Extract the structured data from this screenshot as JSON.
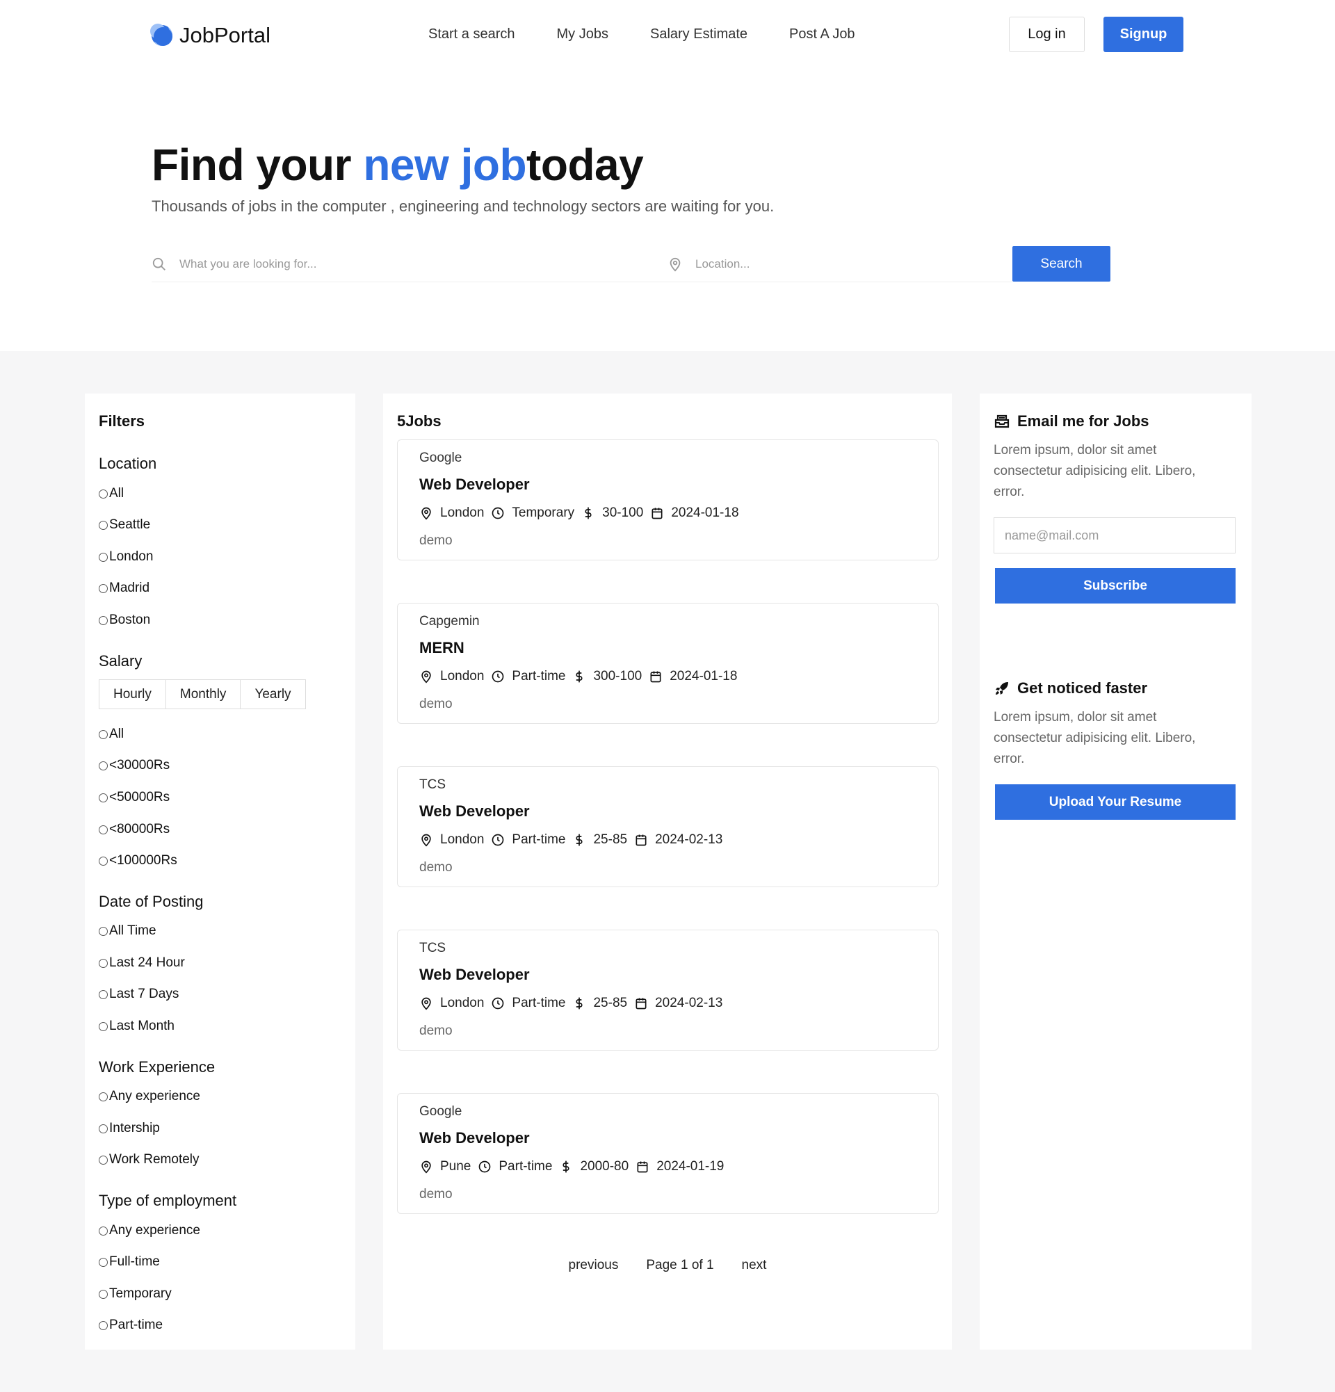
{
  "header": {
    "logo": "JobPortal",
    "menu": [
      "Start a search",
      "My Jobs",
      "Salary Estimate",
      "Post A Job"
    ],
    "login": "Log in",
    "signup": "Signup"
  },
  "hero": {
    "title_part1": "Find your ",
    "title_highlight": "new job",
    "title_part2": "today",
    "subtitle": "Thousands of jobs in the computer , engineering and technology sectors are waiting for you.",
    "search_placeholder": "What you are looking for...",
    "location_placeholder": "Location...",
    "search_button": "Search"
  },
  "filters": {
    "title": "Filters",
    "location": {
      "label": "Location",
      "options": [
        "All",
        "Seattle",
        "London",
        "Madrid",
        "Boston"
      ]
    },
    "salary": {
      "label": "Salary",
      "tabs": [
        "Hourly",
        "Monthly",
        "Yearly"
      ],
      "options": [
        "All",
        "<30000Rs",
        "<50000Rs",
        "<80000Rs",
        "<100000Rs"
      ]
    },
    "date": {
      "label": "Date of Posting",
      "options": [
        "All Time",
        "Last 24 Hour",
        "Last 7 Days",
        "Last Month"
      ]
    },
    "experience": {
      "label": "Work Experience",
      "options": [
        "Any experience",
        "Intership",
        "Work Remotely"
      ]
    },
    "employment": {
      "label": "Type of employment",
      "options": [
        "Any experience",
        "Full-time",
        "Temporary",
        "Part-time"
      ]
    }
  },
  "jobs": {
    "count": "5Jobs",
    "items": [
      {
        "company": "Google",
        "role": "Web Developer",
        "location": "London",
        "type": "Temporary",
        "salary": "30-100",
        "date": "2024-01-18",
        "desc": "demo"
      },
      {
        "company": "Capgemin",
        "role": "MERN",
        "location": "London",
        "type": "Part-time",
        "salary": "300-100",
        "date": "2024-01-18",
        "desc": "demo"
      },
      {
        "company": "TCS",
        "role": "Web Developer",
        "location": "London",
        "type": "Part-time",
        "salary": "25-85",
        "date": "2024-02-13",
        "desc": "demo"
      },
      {
        "company": "TCS",
        "role": "Web Developer",
        "location": "London",
        "type": "Part-time",
        "salary": "25-85",
        "date": "2024-02-13",
        "desc": "demo"
      },
      {
        "company": "Google",
        "role": "Web Developer",
        "location": "Pune",
        "type": "Part-time",
        "salary": "2000-80",
        "date": "2024-01-19",
        "desc": "demo"
      }
    ],
    "pager": {
      "previous": "previous",
      "page": "Page 1 of 1",
      "next": "next"
    }
  },
  "side": {
    "email_title": "Email me for Jobs",
    "email_text": "Lorem ipsum, dolor sit amet consectetur adipisicing elit. Libero, error.",
    "email_placeholder": "name@mail.com",
    "subscribe": "Subscribe",
    "noticed_title": "Get noticed faster",
    "noticed_text": "Lorem ipsum, dolor sit amet consectetur adipisicing elit. Libero, error.",
    "upload": "Upload Your Resume"
  },
  "colors": {
    "accent": "#2f6fe0"
  }
}
